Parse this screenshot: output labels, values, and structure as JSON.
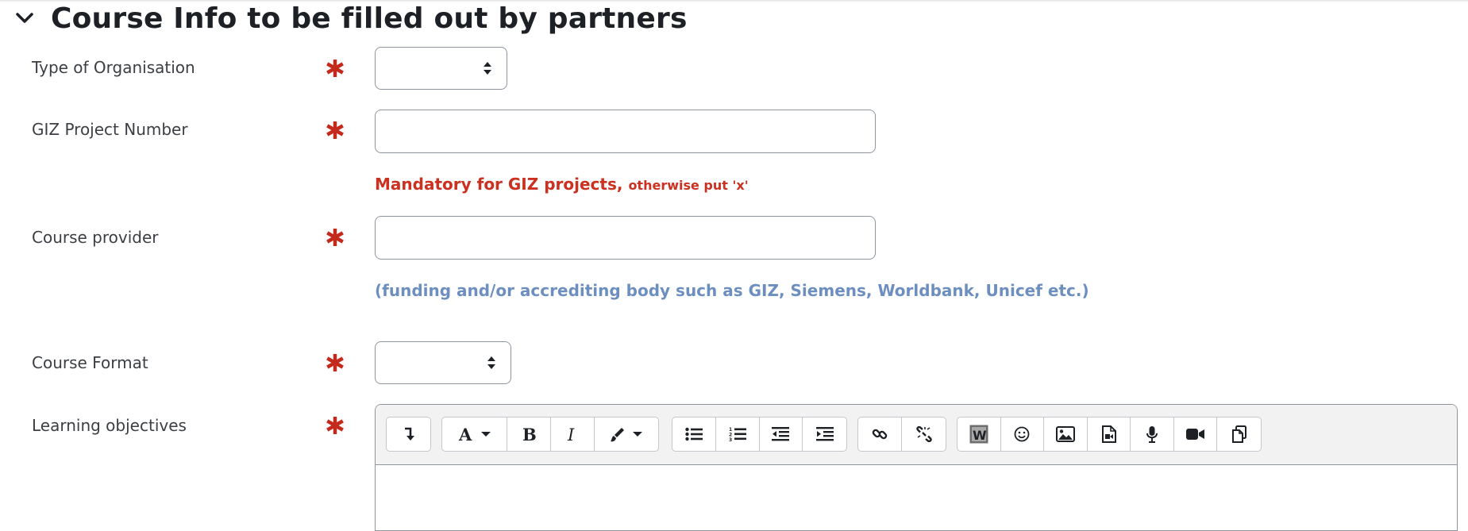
{
  "section": {
    "title": "Course Info to be filled out by partners",
    "toggle_icon": "chevron-down-icon"
  },
  "colors": {
    "required": "#c42a1c",
    "hint_red": "#ca3120",
    "hint_blue": "#6d8fc0",
    "border": "#8f959e"
  },
  "fields": {
    "type_of_organisation": {
      "label": "Type of Organisation",
      "value": ""
    },
    "giz_project_number": {
      "label": "GIZ Project Number",
      "value": "",
      "hint_main": "Mandatory for GIZ projects, ",
      "hint_small": "otherwise put 'x'"
    },
    "course_provider": {
      "label": "Course provider",
      "value": "",
      "hint": "(funding and/or accrediting body such as GIZ, Siemens, Worldbank, Unicef etc.)"
    },
    "course_format": {
      "label": "Course Format",
      "value": ""
    },
    "learning_objectives": {
      "label": "Learning objectives",
      "toolbar_icons": [
        "show-more-icon",
        "font-family-icon",
        "bold-icon",
        "italic-icon",
        "font-color-icon",
        "unordered-list-icon",
        "ordered-list-icon",
        "outdent-icon",
        "indent-icon",
        "link-icon",
        "unlink-icon",
        "word-import-icon",
        "emoji-icon",
        "image-icon",
        "media-icon",
        "record-audio-icon",
        "record-video-icon",
        "manage-files-icon"
      ]
    }
  }
}
